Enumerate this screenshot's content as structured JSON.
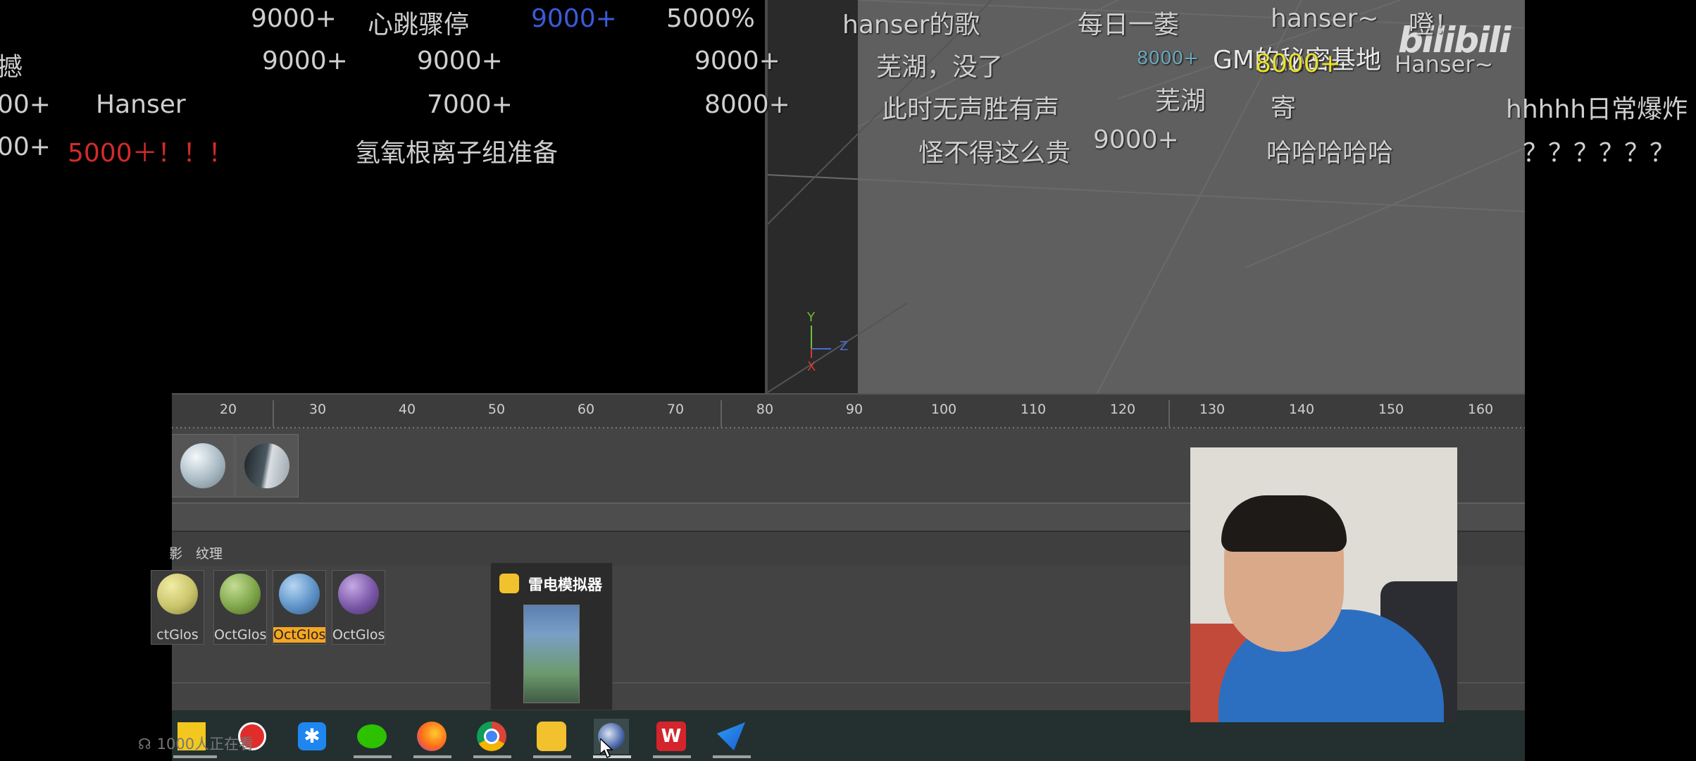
{
  "danmaku": [
    {
      "text": "9000+",
      "color": "#cfcfcf"
    },
    {
      "text": "心跳骤停",
      "color": "#cfcfcf"
    },
    {
      "text": "9000+",
      "color": "#3b5bd6"
    },
    {
      "text": "5000%",
      "color": "#cfcfcf"
    },
    {
      "text": "hanser的歌",
      "color": "#cfcfcf"
    },
    {
      "text": "每日一萎",
      "color": "#cfcfcf"
    },
    {
      "text": "hanser~",
      "color": "#cfcfcf"
    },
    {
      "text": "噔！",
      "color": "#cfcfcf"
    },
    {
      "text": "撼",
      "color": "#cfcfcf"
    },
    {
      "text": "9000+",
      "color": "#cfcfcf"
    },
    {
      "text": "9000+",
      "color": "#cfcfcf"
    },
    {
      "text": "9000+",
      "color": "#cfcfcf"
    },
    {
      "text": "芜湖，没了",
      "color": "#cfcfcf"
    },
    {
      "text": "8000+",
      "color": "#6aa6b8"
    },
    {
      "text": "GM的秘密基地",
      "color": "#e8e8e8"
    },
    {
      "text": "8000+",
      "color": "#e8e030"
    },
    {
      "text": "Hanser~",
      "color": "#cfcfcf"
    },
    {
      "text": "00+",
      "color": "#cfcfcf"
    },
    {
      "text": "Hanser",
      "color": "#cfcfcf"
    },
    {
      "text": "7000+",
      "color": "#cfcfcf"
    },
    {
      "text": "8000+",
      "color": "#cfcfcf"
    },
    {
      "text": "此时无声胜有声",
      "color": "#cfcfcf"
    },
    {
      "text": "芜湖",
      "color": "#cfcfcf"
    },
    {
      "text": "寄",
      "color": "#cfcfcf"
    },
    {
      "text": "hhhhh日常爆炸",
      "color": "#cfcfcf"
    },
    {
      "text": "00+",
      "color": "#cfcfcf"
    },
    {
      "text": "5000＋！！！",
      "color": "#d42a2a"
    },
    {
      "text": "氢氧根离子组准备",
      "color": "#cfcfcf"
    },
    {
      "text": "怪不得这么贵",
      "color": "#cfcfcf"
    },
    {
      "text": "9000+",
      "color": "#cfcfcf"
    },
    {
      "text": "哈哈哈哈哈",
      "color": "#cfcfcf"
    },
    {
      "text": "？？？？？？",
      "color": "#cfcfcf"
    }
  ],
  "bilibili_logo": "bilibili",
  "viewport": {
    "axis": {
      "y": "Y",
      "z": "Z",
      "x": "X"
    },
    "axis_colors": {
      "y": "#6fbf3a",
      "z": "#4a6cd4",
      "x": "#d23b3b"
    }
  },
  "timeline": {
    "ticks": [
      "20",
      "30",
      "40",
      "50",
      "60",
      "70",
      "80",
      "90",
      "100",
      "110",
      "120",
      "130",
      "140",
      "150",
      "160"
    ]
  },
  "material_tab": {
    "partial_label": "影",
    "label": "纹理"
  },
  "materials": [
    {
      "name": "ctGlos",
      "color": "#c9c46a",
      "selected": false
    },
    {
      "name": "OctGlos",
      "color": "#7fa64a",
      "selected": false
    },
    {
      "name": "OctGlos",
      "color": "#5e93c8",
      "selected": true
    },
    {
      "name": "OctGlos",
      "color": "#7b57a8",
      "selected": false
    }
  ],
  "popup": {
    "title": "雷电模拟器"
  },
  "watching": "1000人正在看",
  "accent": "#f5a623",
  "taskbar_icons": [
    "sticky-notes-icon",
    "netease-music-icon",
    "dingtalk-icon",
    "wechat-icon",
    "firefox-icon",
    "chrome-icon",
    "ldplayer-icon",
    "cinema4d-icon",
    "wps-icon",
    "feishu-icon"
  ]
}
